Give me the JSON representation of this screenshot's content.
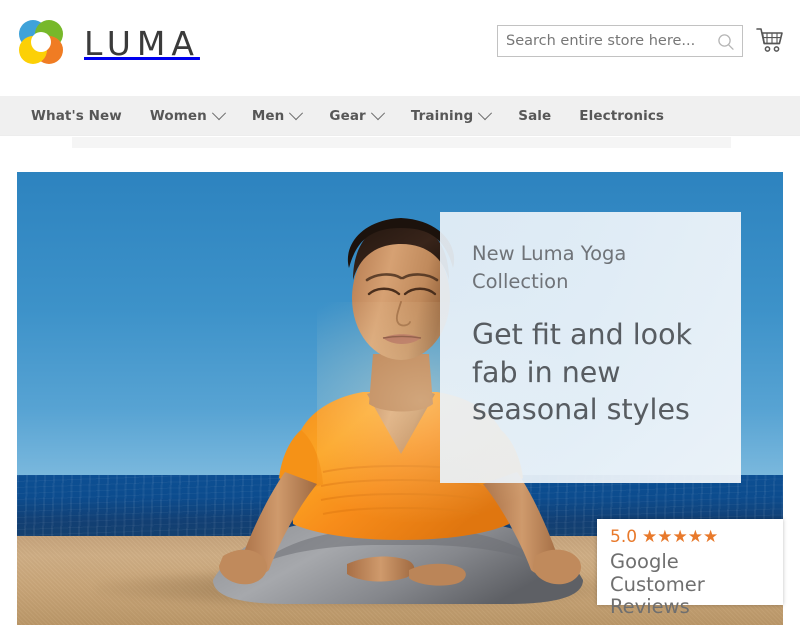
{
  "header": {
    "logo": {
      "name": "LUMA",
      "colors": {
        "blue": "#3fa2d9",
        "green": "#77b82a",
        "orange": "#f07c23",
        "yellow": "#fcd006",
        "teal_overlap": "#1f7a5a",
        "olive_overlap": "#6b7a1f",
        "brown_overlap": "#8c5a27"
      }
    },
    "search": {
      "placeholder": "Search entire store here...",
      "value": "",
      "icon": "search-icon"
    },
    "cart": {
      "icon": "shopping-cart-icon",
      "count": ""
    }
  },
  "nav": {
    "items": [
      {
        "label": "What's New",
        "has_dropdown": false
      },
      {
        "label": "Women",
        "has_dropdown": true
      },
      {
        "label": "Men",
        "has_dropdown": true
      },
      {
        "label": "Gear",
        "has_dropdown": true
      },
      {
        "label": "Training",
        "has_dropdown": true
      },
      {
        "label": "Sale",
        "has_dropdown": false
      },
      {
        "label": "Electronics",
        "has_dropdown": false
      }
    ]
  },
  "banner": {
    "promo": {
      "eyebrow": "New Luma Yoga Collection",
      "headline": "Get fit and look fab in new seasonal styles"
    },
    "scene": {
      "description": "Woman in orange top meditating cross-legged on a beach with blue sky and ocean",
      "sky_color": "#3d8cc4",
      "sea_color": "#0d4f93",
      "sand_color": "#c9a679",
      "top_color": "#f68b1f"
    }
  },
  "reviews_badge": {
    "score": "5.0",
    "stars": "★★★★★",
    "line1": "Google",
    "line2": "Customer Reviews",
    "accent_color": "#e8792b"
  }
}
